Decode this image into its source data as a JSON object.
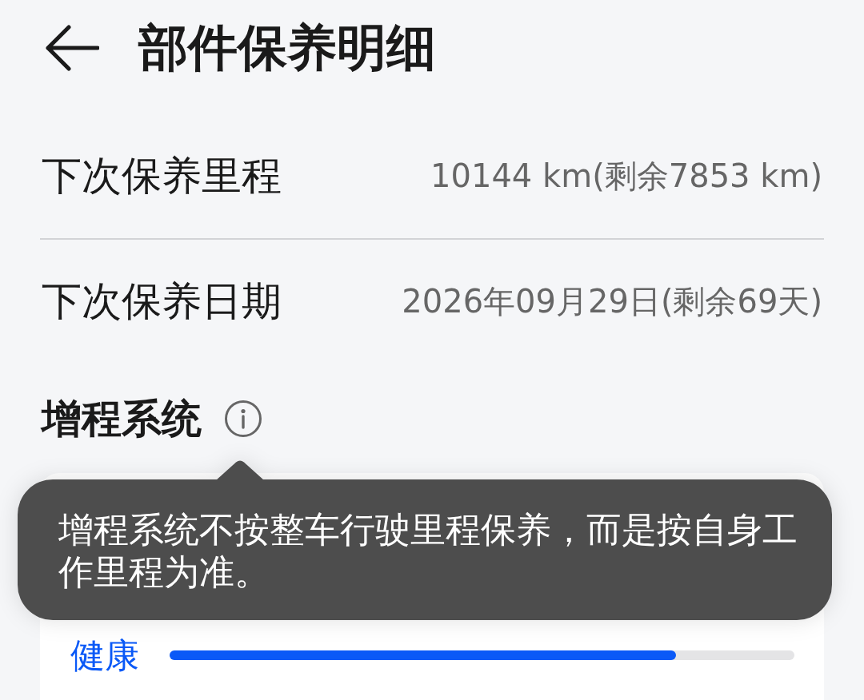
{
  "header": {
    "title": "部件保养明细"
  },
  "rows": [
    {
      "label": "下次保养里程",
      "value": "10144 km(剩余7853 km)"
    },
    {
      "label": "下次保养日期",
      "value": "2026年09月29日(剩余69天)"
    }
  ],
  "section": {
    "title": "增程系统",
    "tooltip": "增程系统不按整车行驶里程保养，而是按自身工作里程为准。",
    "status": {
      "label": "健康",
      "level": 0.81
    }
  }
}
